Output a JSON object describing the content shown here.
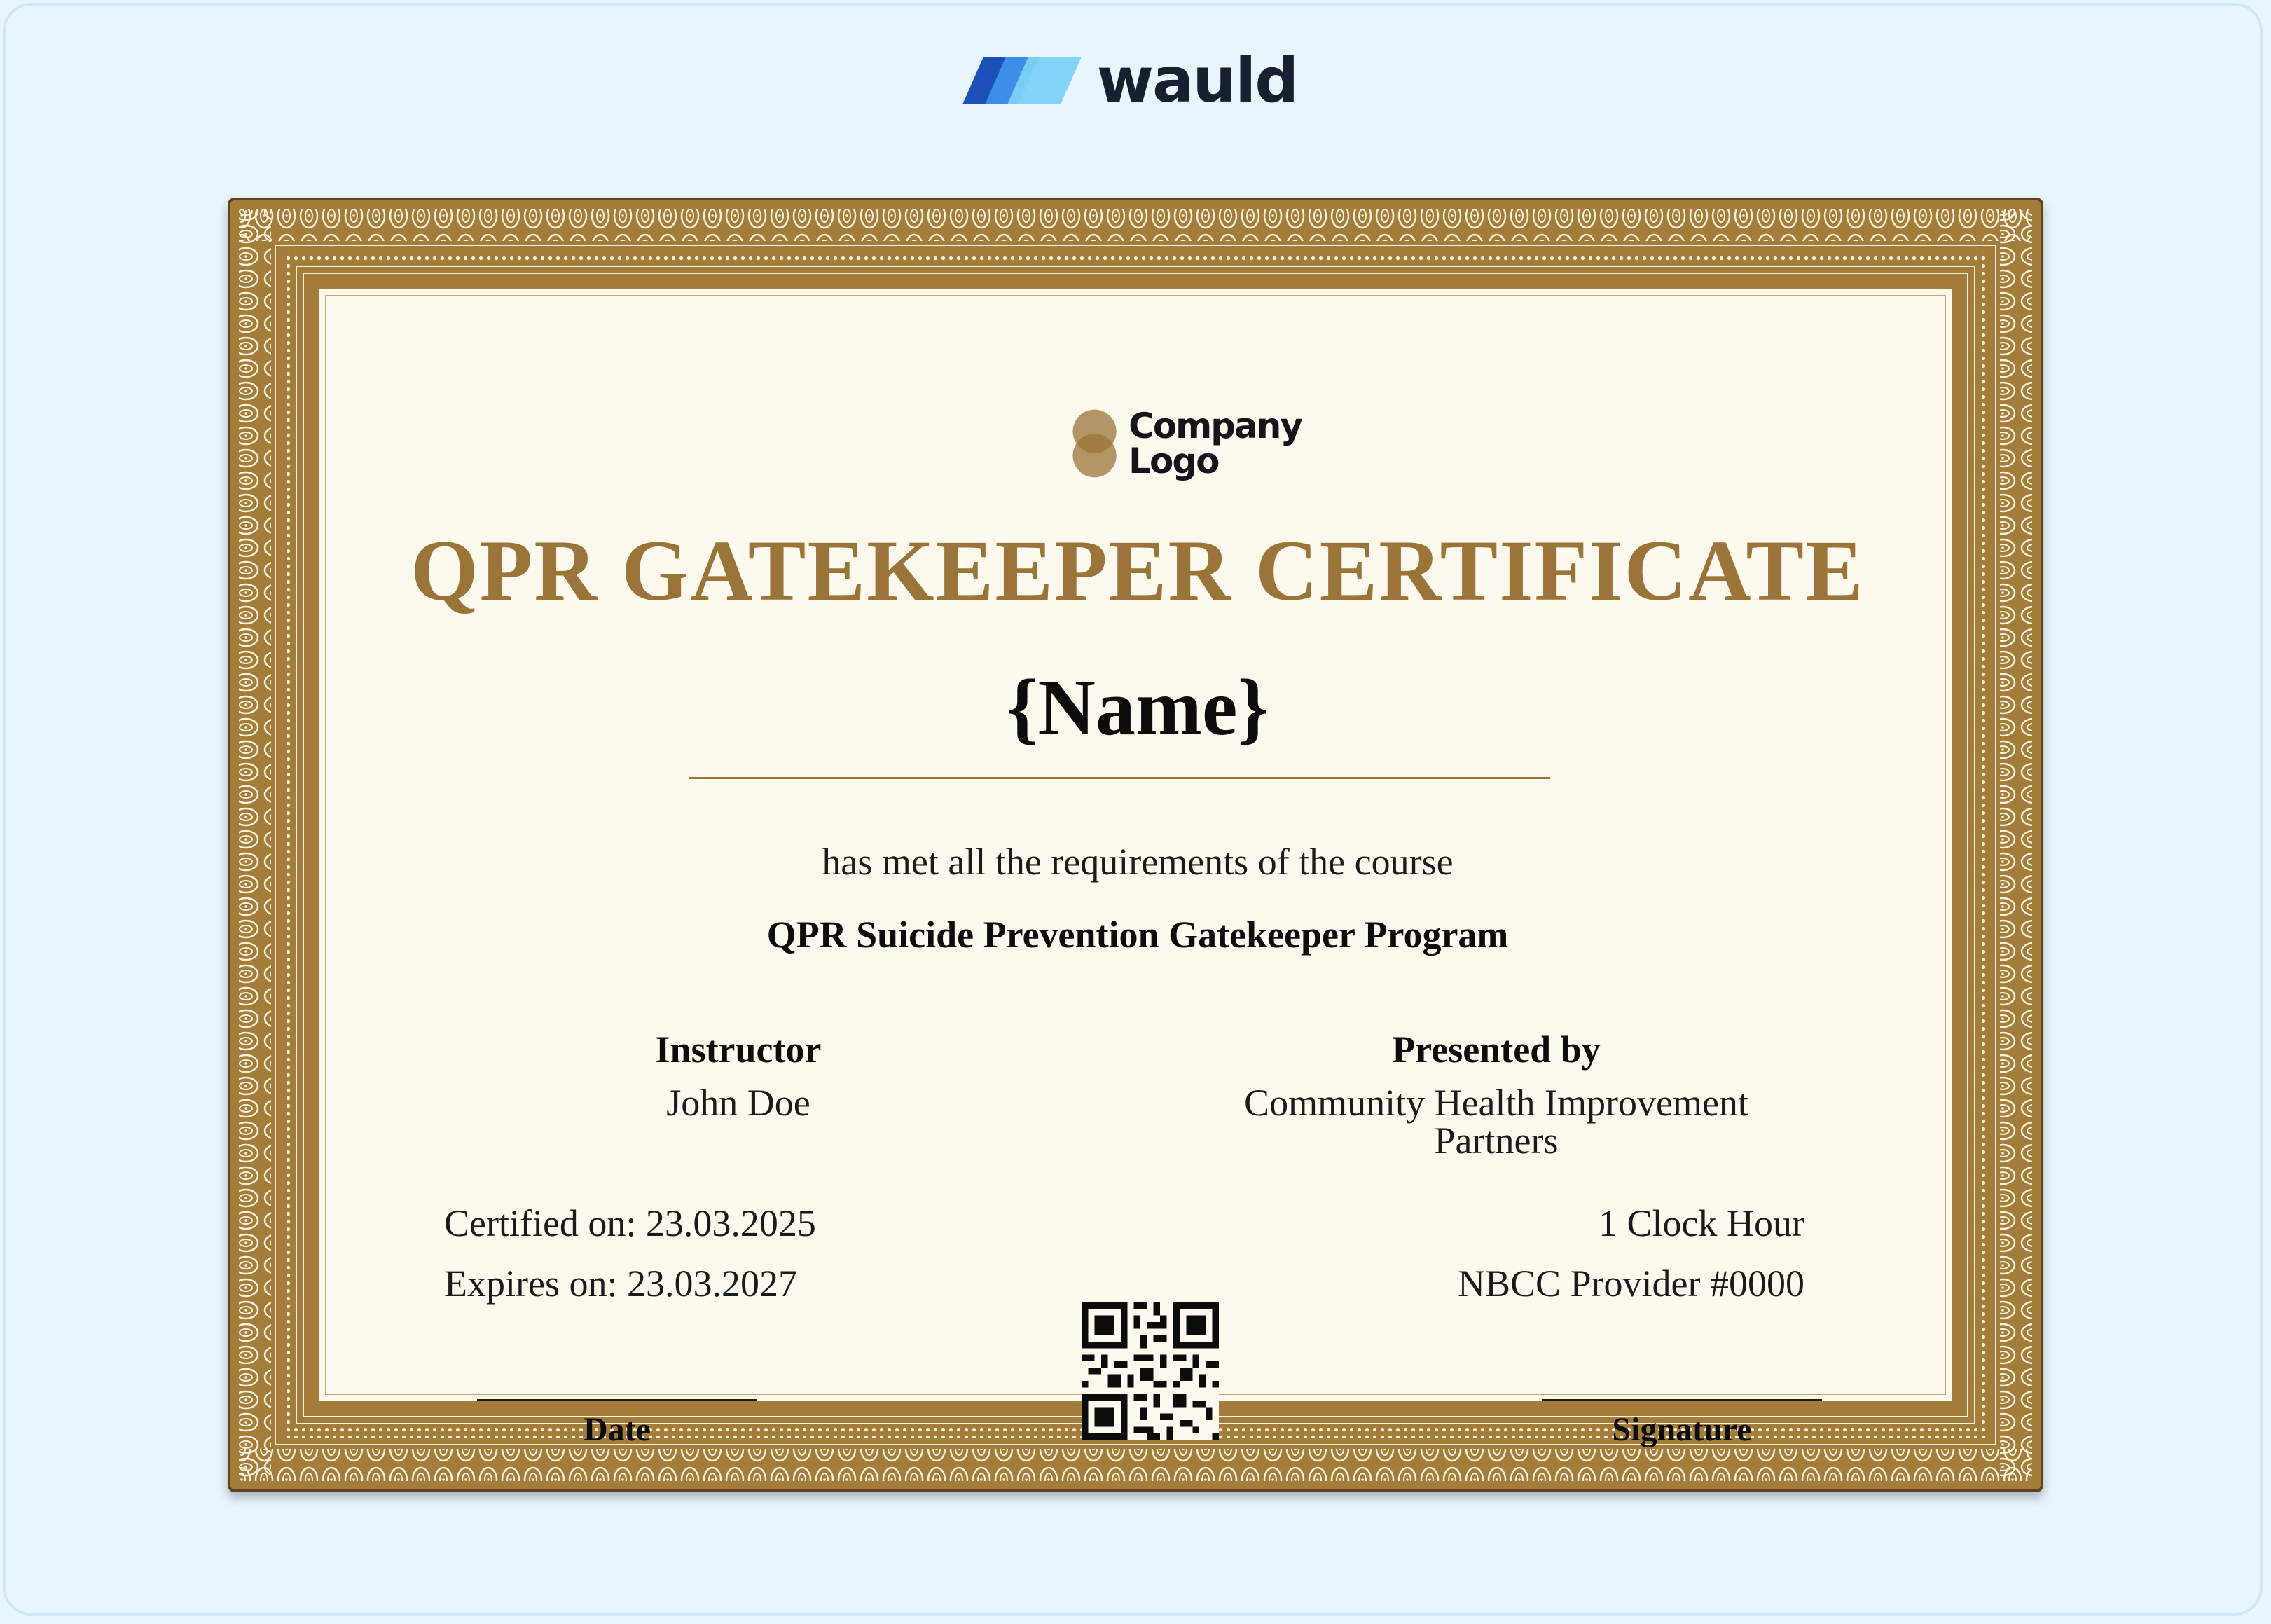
{
  "brand": {
    "name": "wauld"
  },
  "certificate": {
    "logo": {
      "line1": "Company",
      "line2": "Logo"
    },
    "title": "QPR GATEKEEPER CERTIFICATE",
    "recipient_name": "{Name}",
    "requirement_text": "has met all the requirements of the course",
    "course_name": "QPR Suicide Prevention Gatekeeper Program",
    "instructor": {
      "label": "Instructor",
      "value": "John Doe"
    },
    "presented_by": {
      "label": "Presented by",
      "value": "Community Health Improvement Partners"
    },
    "certified_on": "Certified on: 23.03.2025",
    "expires_on": "Expires on: 23.03.2027",
    "clock_hours": "1 Clock Hour",
    "provider": "NBCC Provider #0000",
    "date_label": "Date",
    "signature_label": "Signature"
  },
  "colors": {
    "background": "#e9f5fd",
    "gold": "#9a7438",
    "paper": "#fef9ee",
    "brand_blue_dark": "#1d4fb8",
    "brand_blue_light": "#6cc7f5"
  },
  "icons": {
    "brand": "wauld-logo-icon",
    "company": "company-logo-icon",
    "qr": "qr-code-icon"
  }
}
